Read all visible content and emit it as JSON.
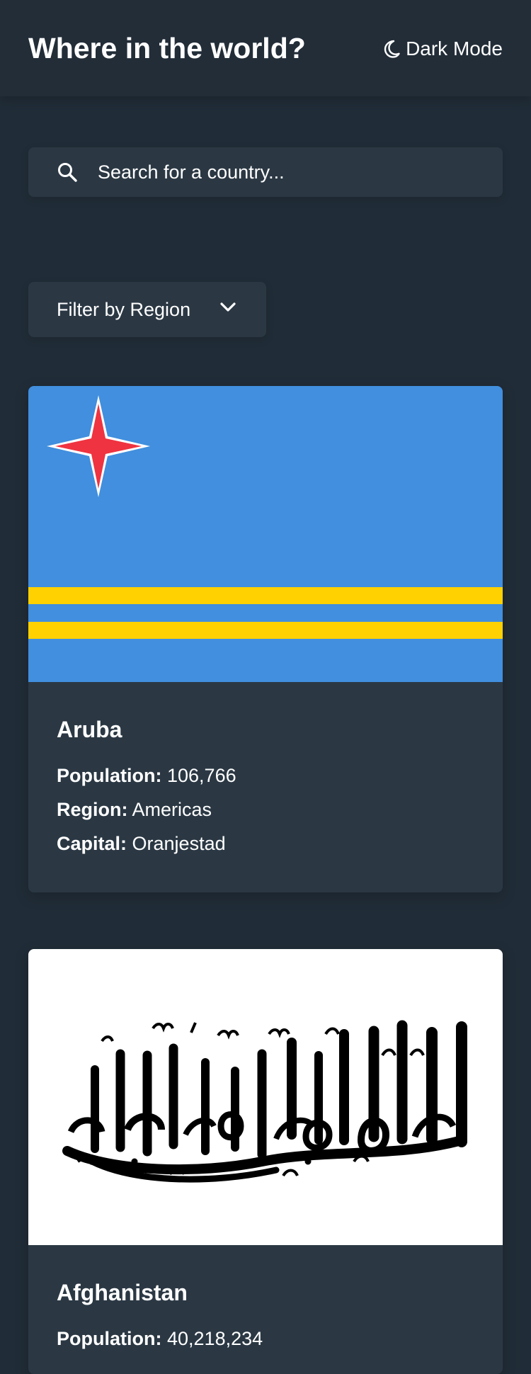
{
  "header": {
    "title": "Where in the world?",
    "theme_toggle": "Dark Mode",
    "theme_icon": "moon-icon"
  },
  "search": {
    "placeholder": "Search for a country...",
    "icon": "search-icon"
  },
  "filter": {
    "label": "Filter by Region",
    "icon": "chevron-down-icon"
  },
  "labels": {
    "population": "Population:",
    "region": "Region:",
    "capital": "Capital:"
  },
  "countries": [
    {
      "name": "Aruba",
      "population": "106,766",
      "region": "Americas",
      "capital": "Oranjestad",
      "flag": "aruba-flag"
    },
    {
      "name": "Afghanistan",
      "population": "40,218,234",
      "flag": "afghanistan-flag"
    }
  ],
  "colors": {
    "background": "#202c37",
    "elements": "#2b3844",
    "text": "#ffffff",
    "aruba_blue": "#418fde",
    "aruba_yellow": "#ffd100",
    "aruba_red": "#ef3340"
  }
}
